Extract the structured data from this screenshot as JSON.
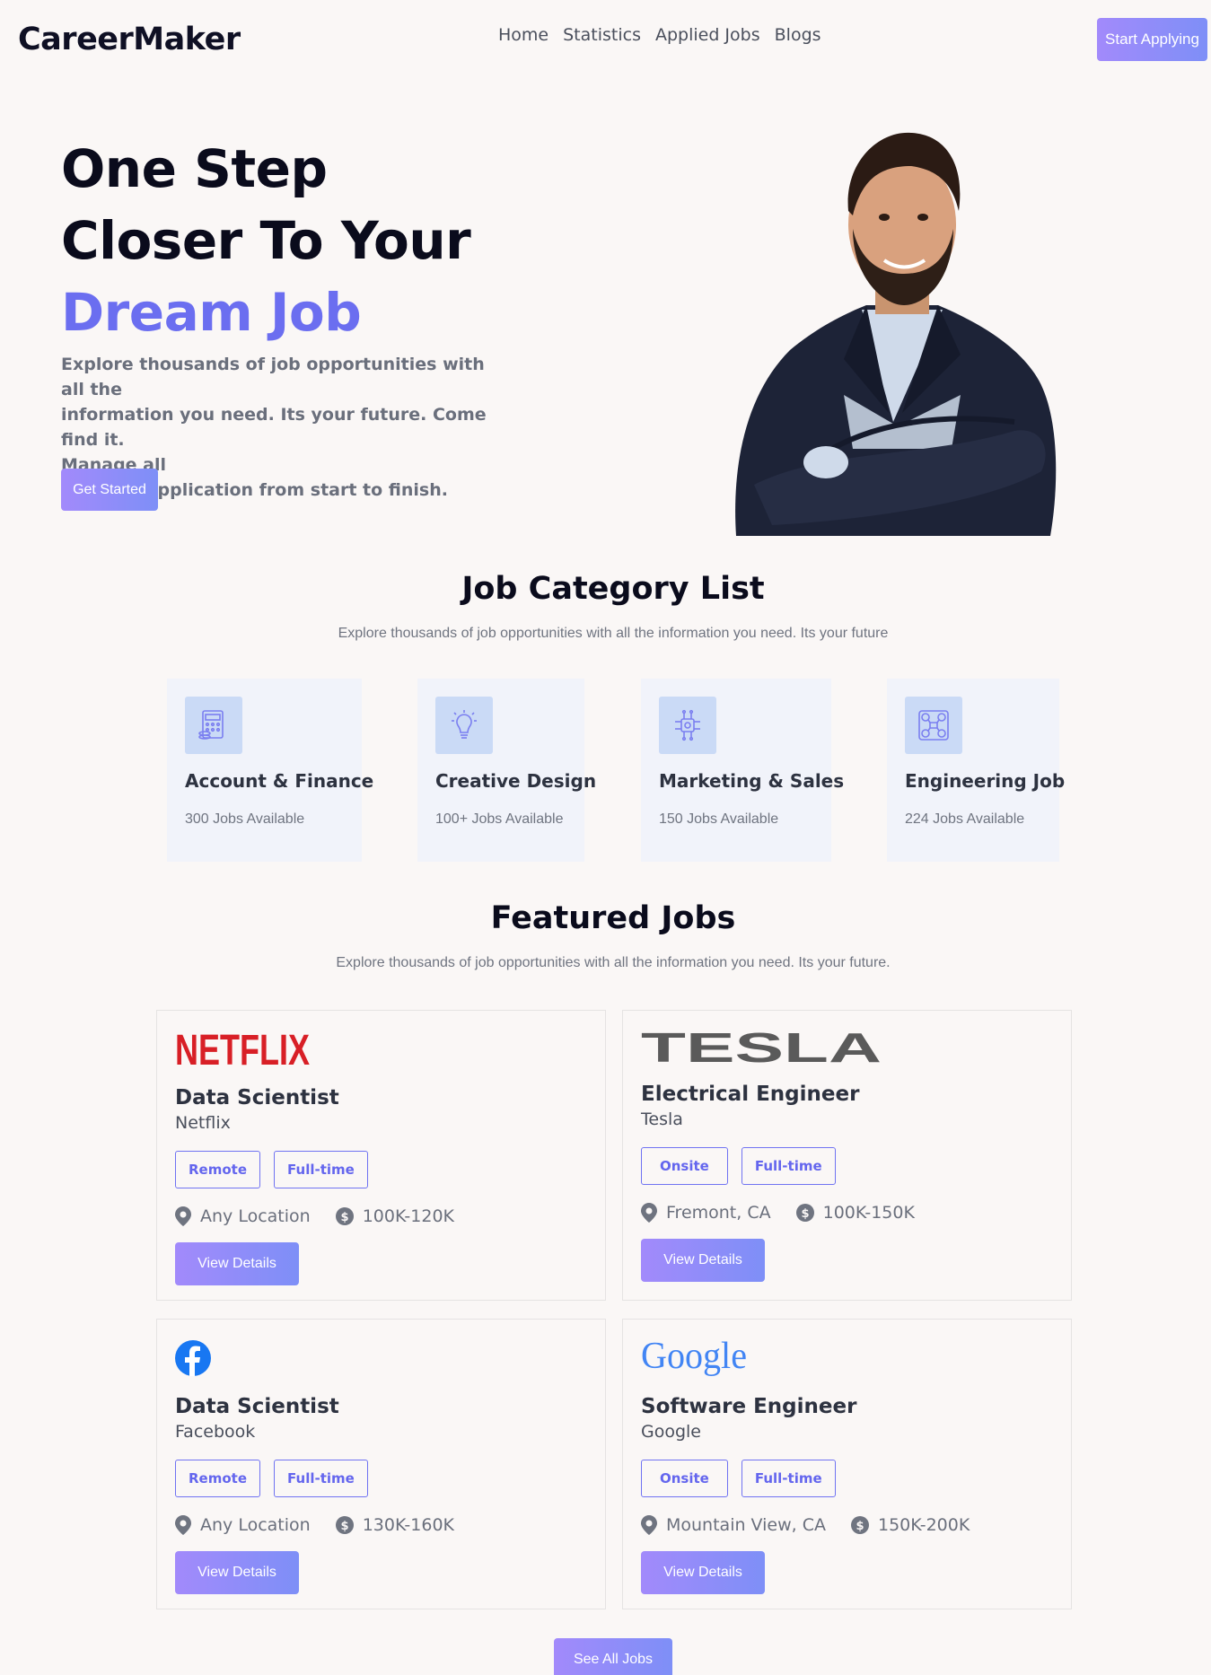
{
  "header": {
    "brand": "CareerMaker",
    "nav": [
      "Home",
      "Statistics",
      "Applied Jobs",
      "Blogs"
    ],
    "cta": "Start Applying"
  },
  "hero": {
    "line1": "One Step",
    "line2": "Closer To Your",
    "line3": "Dream Job",
    "description": "Explore thousands of job opportunities with all the information you need. Its your future. Come find it. Manage all your job application from start to finish.",
    "desc_lines": [
      "Explore thousands of job opportunities with all the",
      "information you need. Its your future. Come find it.",
      "Manage all",
      "your job application from start to finish."
    ],
    "cta": "Get Started"
  },
  "categories": {
    "title": "Job Category List",
    "subtitle": "Explore thousands of job opportunities with all the information you need. Its your future",
    "items": [
      {
        "name": "Account & Finance",
        "count": "300 Jobs Available",
        "icon": "calculator-icon"
      },
      {
        "name": "Creative Design",
        "count": "100+ Jobs Available",
        "icon": "lightbulb-icon"
      },
      {
        "name": "Marketing & Sales",
        "count": "150 Jobs Available",
        "icon": "chip-icon"
      },
      {
        "name": "Engineering Job",
        "count": "224 Jobs Available",
        "icon": "network-icon"
      }
    ]
  },
  "featured": {
    "title": "Featured Jobs",
    "subtitle": "Explore thousands of job opportunities with all the information you need. Its your future.",
    "jobs": [
      {
        "logo": "NETFLIX",
        "title": "Data Scientist",
        "company": "Netflix",
        "tags": [
          "Remote",
          "Full-time"
        ],
        "location": "Any Location",
        "salary": "100K-120K",
        "button": "View Details"
      },
      {
        "logo": "TESLA",
        "title": "Electrical Engineer",
        "company": "Tesla",
        "tags": [
          "Onsite",
          "Full-time"
        ],
        "location": "Fremont, CA",
        "salary": "100K-150K",
        "button": "View Details"
      },
      {
        "logo": "facebook-logo",
        "title": "Data Scientist",
        "company": "Facebook",
        "tags": [
          "Remote",
          "Full-time"
        ],
        "location": "Any Location",
        "salary": "130K-160K",
        "button": "View Details"
      },
      {
        "logo": "Google",
        "title": "Software Engineer",
        "company": "Google",
        "tags": [
          "Onsite",
          "Full-time"
        ],
        "location": "Mountain View, CA",
        "salary": "150K-200K",
        "button": "View Details"
      }
    ],
    "see_all": "See All Jobs"
  },
  "colors": {
    "accent": "#6b6ef0",
    "button_gradient_start": "#a28afb",
    "button_gradient_end": "#7e8ff7",
    "background": "#faf7f6",
    "category_card_bg": "#f1f3fa"
  }
}
